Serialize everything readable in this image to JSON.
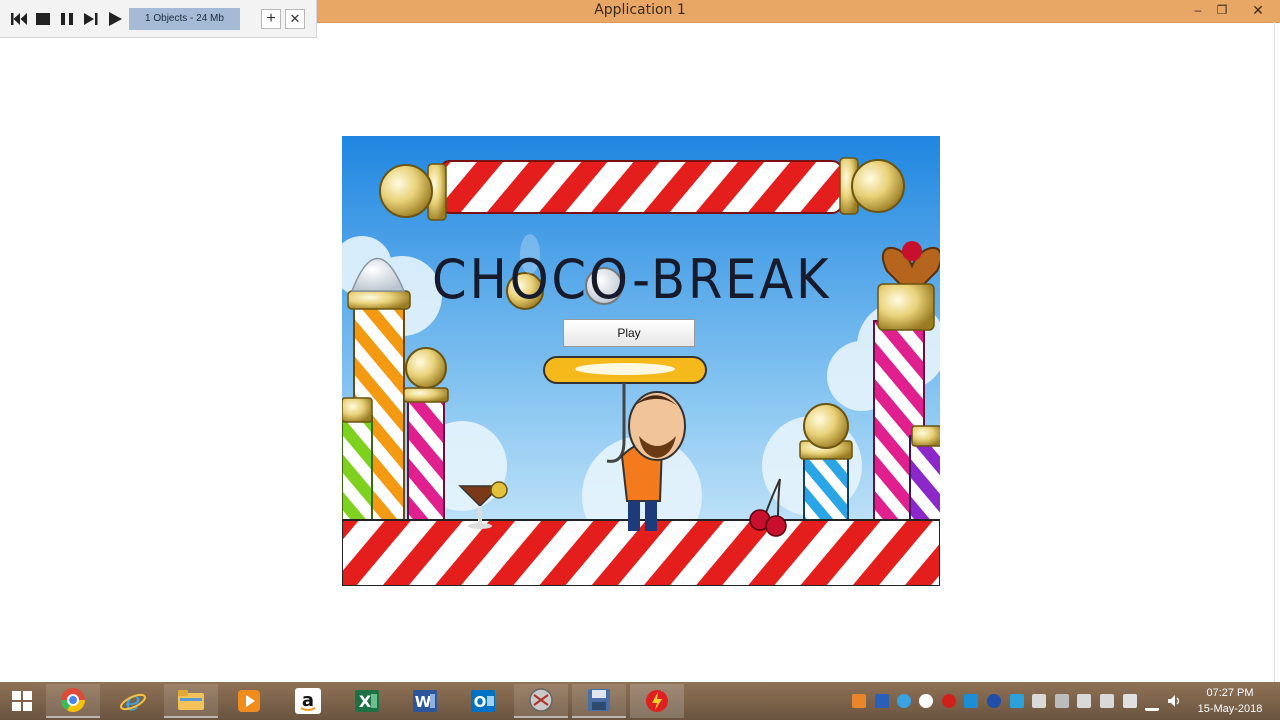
{
  "window": {
    "title": "Application 1",
    "minimize": "–",
    "restore": "❐",
    "close": "✕"
  },
  "toolbar": {
    "status": "1 Objects - 24 Mb",
    "add": "+",
    "remove": "✕",
    "buttons": [
      "skip-back-icon",
      "stop-icon",
      "pause-icon",
      "step-forward-icon",
      "play-icon"
    ]
  },
  "game": {
    "title": "CHOCO-BREAK",
    "play_button": "Play"
  },
  "taskbar": {
    "apps": [
      "windows-start-icon",
      "chrome-icon",
      "internet-explorer-icon",
      "file-explorer-icon",
      "media-player-icon",
      "amazon-icon",
      "excel-icon",
      "word-icon",
      "outlook-icon",
      "app-icon",
      "floppy-app-icon",
      "flash-app-icon"
    ],
    "clock": {
      "time": "07:27 PM",
      "date": "15-May-2018"
    }
  }
}
